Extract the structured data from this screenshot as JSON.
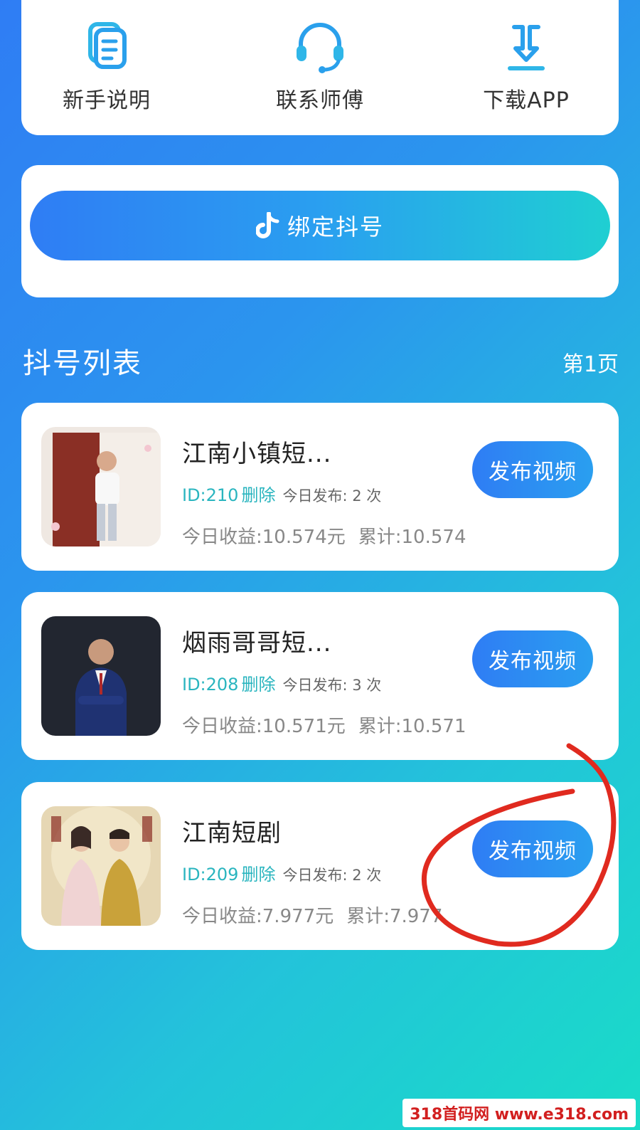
{
  "quick_actions": [
    {
      "label": "新手说明",
      "icon": "guide-doc-icon"
    },
    {
      "label": "联系师傅",
      "icon": "headset-icon"
    },
    {
      "label": "下载APP",
      "icon": "download-icon"
    }
  ],
  "bind": {
    "label": "绑定抖号",
    "icon": "tiktok-note-icon"
  },
  "list": {
    "title": "抖号列表",
    "page": "第1页"
  },
  "accounts": [
    {
      "name": "江南小镇短...",
      "id": "ID:210",
      "delete_label": "删除",
      "today_publish": "今日发布: 2 次",
      "today_income": "今日收益:10.574元",
      "total": "累计:10.574",
      "publish_label": "发布视频"
    },
    {
      "name": "烟雨哥哥短...",
      "id": "ID:208",
      "delete_label": "删除",
      "today_publish": "今日发布: 3 次",
      "today_income": "今日收益:10.571元",
      "total": "累计:10.571",
      "publish_label": "发布视频"
    },
    {
      "name": "江南短剧",
      "id": "ID:209",
      "delete_label": "删除",
      "today_publish": "今日发布: 2 次",
      "today_income": "今日收益:7.977元",
      "total": "累计:7.977",
      "publish_label": "发布视频"
    }
  ],
  "colors": {
    "accent_blue": "#2f7df4",
    "accent_teal": "#2ab5bf",
    "annotation_red": "#e02a1f"
  },
  "watermark": "318首码网 www.e318.com"
}
